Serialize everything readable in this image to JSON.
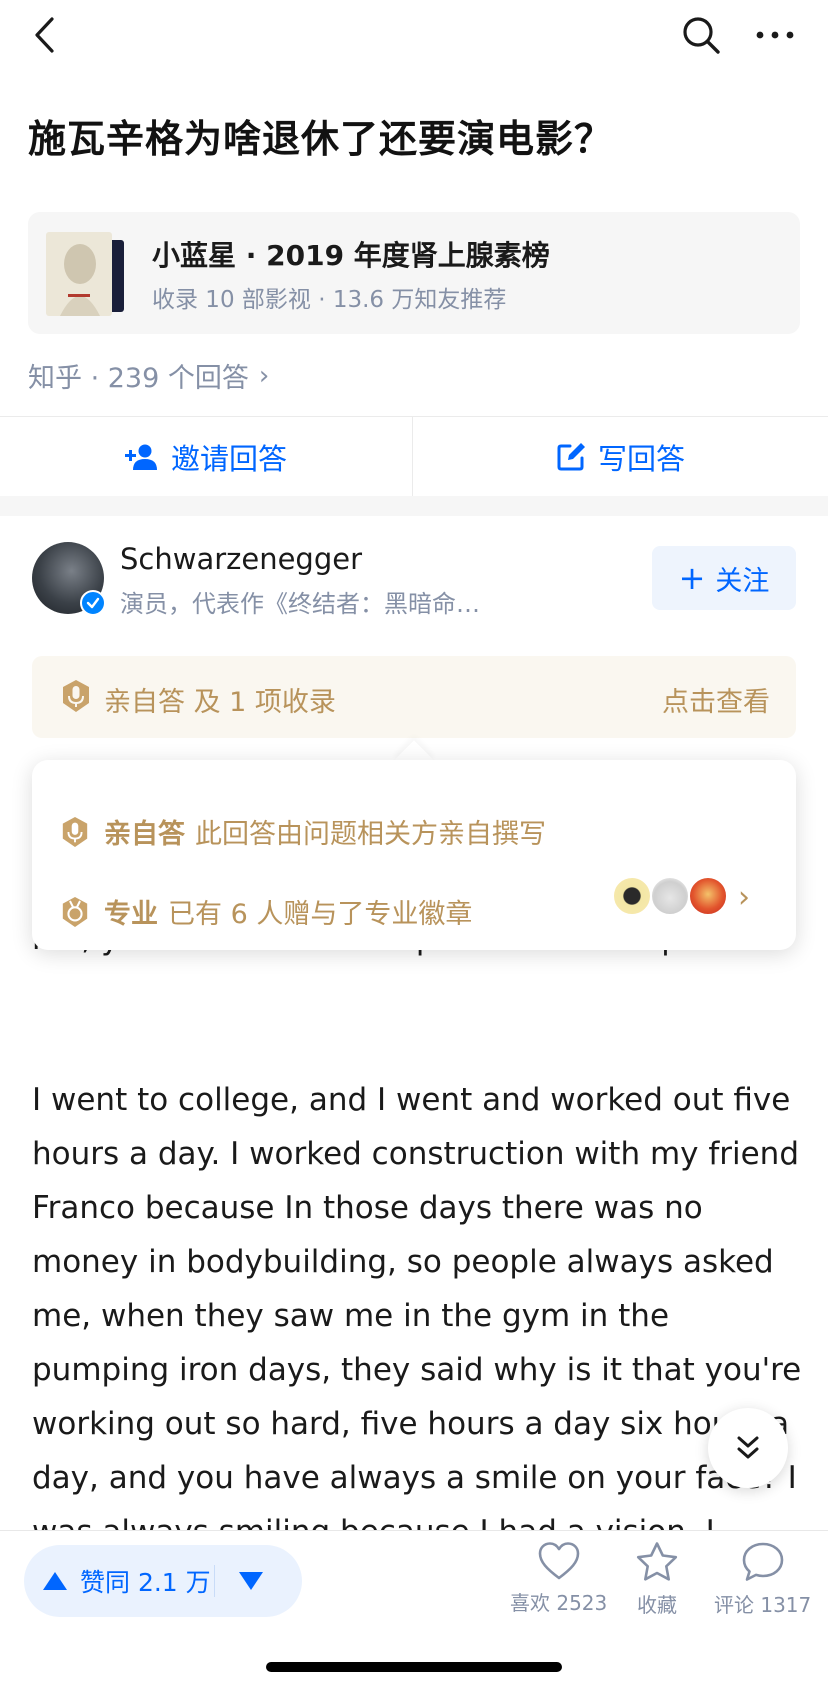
{
  "question": {
    "title": "施瓦辛格为啥退休了还要演电影？"
  },
  "list_card": {
    "title": "小蓝星 · 2019 年度肾上腺素榜",
    "subtitle": "收录 10 部影视 · 13.6 万知友推荐"
  },
  "meta": {
    "text": "知乎 · 239 个回答",
    "chevron": "›"
  },
  "actions": {
    "invite": "邀请回答",
    "write": "写回答"
  },
  "author": {
    "name": "Schwarzenegger",
    "bio": "演员，代表作《终结者：黑暗命…",
    "follow_label": "关注",
    "follow_plus": "+"
  },
  "badge_bar": {
    "text": "亲自答 及 1 项收录",
    "link": "点击查看"
  },
  "popover": {
    "row1_label": "亲自答",
    "row1_desc": "此回答由问题相关方亲自撰写",
    "row2_label": "专业",
    "row2_desc": "已有 6 人赠与了专业徽章",
    "chevron": "›"
  },
  "answer": {
    "p1": "me, you would never stop or want to stop.",
    "p2": "I went to college, and I went and worked out five hours a day. I worked construction with my friend Franco because In those days there was no money in bodybuilding, so people always asked me, when they saw me in the gym in the pumping iron days, they said why is it that you're working out so hard, five hours a day six hours a day, and you have always a smile on your face? I was always smiling because I had a vision. I made a"
  },
  "bottom_bar": {
    "vote_label": "赞同 2.1 万",
    "like_label": "喜欢 2523",
    "fav_label": "收藏",
    "comment_label": "评论 1317"
  },
  "colors": {
    "accent": "#0066ff",
    "gold": "#b8935b",
    "gray_text": "#8590a6"
  }
}
